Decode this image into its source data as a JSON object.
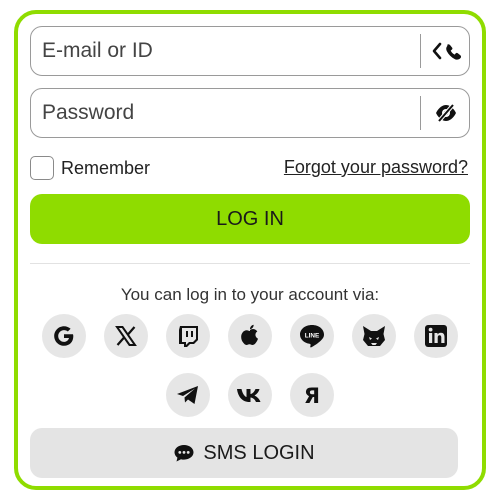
{
  "form": {
    "email_placeholder": "E-mail or ID",
    "password_placeholder": "Password",
    "remember_label": "Remember",
    "forgot_link": "Forgot your password?",
    "login_button": "LOG IN"
  },
  "social": {
    "prompt": "You can log in to your account via:",
    "providers": [
      "google",
      "x",
      "twitch",
      "apple",
      "line",
      "metamask",
      "linkedin",
      "telegram",
      "vk",
      "yandex"
    ]
  },
  "sms": {
    "button_label": "SMS LOGIN"
  },
  "colors": {
    "accent": "#8fdc00",
    "button_grey": "#e4e4e4",
    "icon_bg": "#e6e6e6"
  }
}
